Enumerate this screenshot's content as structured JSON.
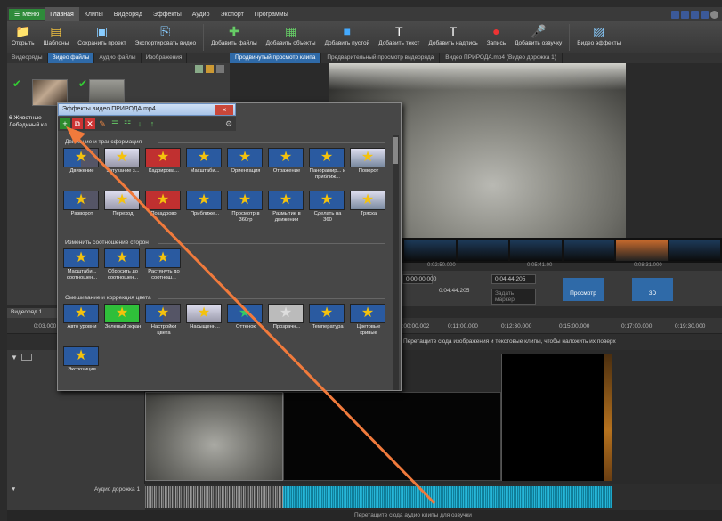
{
  "menubar": {
    "menu_label": "Меню",
    "tabs": [
      "Главная",
      "Клипы",
      "Видеоряд",
      "Эффекты",
      "Аудио",
      "Экспорт",
      "Программы"
    ]
  },
  "ribbon": {
    "buttons": [
      {
        "label": "Открыть",
        "icon": "folder-icon"
      },
      {
        "label": "Шаблоны",
        "icon": "template-icon"
      },
      {
        "label": "Сохранить проект",
        "icon": "save-icon"
      },
      {
        "label": "Экспортировать видео",
        "icon": "export-icon"
      },
      {
        "label": "Добавить файлы",
        "icon": "add-file-icon"
      },
      {
        "label": "Добавить объекты",
        "icon": "add-objects-icon"
      },
      {
        "label": "Добавить пустой",
        "icon": "add-blank-icon"
      },
      {
        "label": "Добавить текст",
        "icon": "text-icon"
      },
      {
        "label": "Добавить надпись",
        "icon": "caption-icon"
      },
      {
        "label": "Запись",
        "icon": "record-icon"
      },
      {
        "label": "Добавить озвучку",
        "icon": "voiceover-icon"
      },
      {
        "label": "Видео эффекты",
        "icon": "effects-icon"
      }
    ]
  },
  "left_panel": {
    "tabs": [
      "Видеоряды",
      "Видео файлы",
      "Аудио файлы",
      "Изображения"
    ],
    "active_tab": 1,
    "file_caption": "6 Животные Лебединый кл..."
  },
  "preview": {
    "tabs": [
      "Продвинутый просмотр клипа",
      "Предварительный просмотр видеоряда",
      "Видео ПРИРОДА.mp4 (Видео дорожка 1)"
    ],
    "active_tab": 0
  },
  "filmstrip": {
    "times": [
      "0:02:50.000",
      "0:05:41.00",
      "0:08:31.000"
    ]
  },
  "transport": {
    "timecode_start": "0:00:00.000",
    "timecode_end": "0:04:44.205",
    "timecode_current": "0:04:44.205",
    "marker_label": "Задать маркер",
    "preview_label": "Просмотр",
    "mode_label": "3D"
  },
  "timeline": {
    "tab_label": "Видеоряд 1",
    "ruler_ticks": [
      "0:03.000",
      "0:00:00.002",
      "0:11:00.000",
      "0:12:30.000",
      "0:15:00.000",
      "0:17:00.000",
      "0:19:30.000"
    ],
    "hint": "Перетащите сюда изображения и текстовые клипы, чтобы наложить их поверх",
    "audio_track_label": "Аудио дорожка 1",
    "status_hint": "Перетащите сюда аудио клипы для озвучки"
  },
  "fx_dialog": {
    "title": "Эффекты видео ПРИРОДА.mp4",
    "close_label": "×",
    "sections": [
      {
        "title": "Движение и трансформация",
        "items": [
          "Движение",
          "Затухание з...",
          "Кадрирова...",
          "Масштаби...",
          "Ориентация",
          "Отражение",
          "Панорамир... и приближ...",
          "Поворот",
          "Разворот",
          "Переход",
          "Покадрово",
          "Приближе...",
          "Просмотр в 360гр",
          "Размытие в движении",
          "Сделать на 360",
          "Тряска"
        ]
      },
      {
        "title": "Изменить соотношение сторон",
        "items": [
          "Масштаби... соотношен...",
          "Сбросить до соотношен...",
          "Растянуть до соотнош..."
        ]
      },
      {
        "title": "Смешивание и коррекция цвета",
        "items": [
          "Авто уровни",
          "Зеленый экран",
          "Настройки цвета",
          "Насыщенн...",
          "Оттенок",
          "Прозрачн...",
          "Температура",
          "Цветовые кривые",
          "Экспозиция"
        ]
      }
    ]
  }
}
